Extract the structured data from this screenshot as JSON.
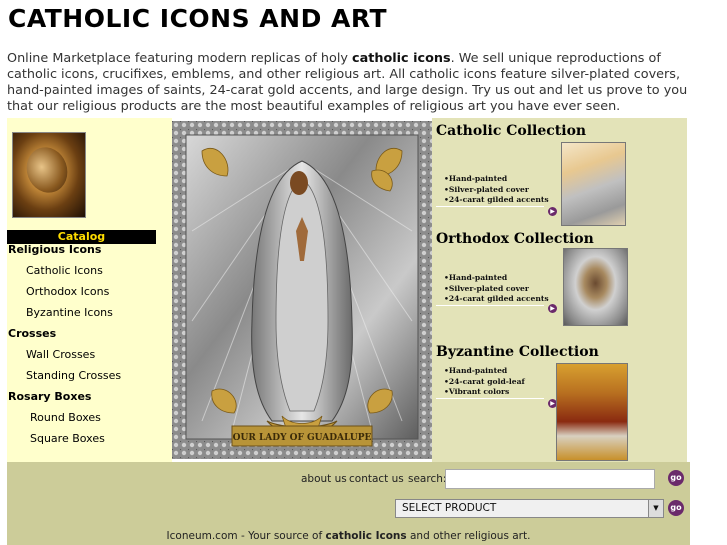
{
  "title": "CATHOLIC ICONS AND ART",
  "intro": {
    "part1": "Online Marketplace featuring modern replicas of holy ",
    "bold": "catholic icons",
    "part2": ". We sell unique reproductions of catholic icons, crucifixes, emblems, and other religious art. All catholic icons feature silver-plated covers, hand-painted images of saints, 24-carat gold accents, and large design. Try us out and let us prove to you that our religious products are the most beautiful examples of religious art you have ever seen."
  },
  "sidebar": {
    "catalog_label": "Catalog",
    "items": [
      {
        "label": "Religious Icons",
        "heading": true
      },
      {
        "label": "Catholic Icons",
        "heading": false
      },
      {
        "label": "Orthodox Icons",
        "heading": false
      },
      {
        "label": "Byzantine Icons",
        "heading": false
      },
      {
        "label": "Crosses",
        "heading": true
      },
      {
        "label": "Wall Crosses",
        "heading": false
      },
      {
        "label": "Standing Crosses",
        "heading": false
      },
      {
        "label": "Rosary Boxes",
        "heading": true
      },
      {
        "label": "Round Boxes",
        "heading": false
      },
      {
        "label": "Square Boxes",
        "heading": false
      }
    ]
  },
  "main_image": {
    "caption": "OUR LADY OF GUADALUPE"
  },
  "collections": [
    {
      "title": "Catholic Collection",
      "features": [
        "Hand-painted",
        "Silver-plated cover",
        "24-carat gilded accents"
      ]
    },
    {
      "title": "Orthodox Collection",
      "features": [
        "Hand-painted",
        "Silver-plated cover",
        "24-carat gilded accents"
      ]
    },
    {
      "title": "Byzantine Collection",
      "features": [
        "Hand-painted",
        "24-carat gold-leaf",
        "Vibrant colors"
      ]
    }
  ],
  "bottom": {
    "about": "about us",
    "contact": "contact us",
    "search_label": "search:",
    "search_value": "",
    "go_label": "go",
    "select_value": "SELECT PRODUCT",
    "footer_part1": "Iconeum.com - Your source of ",
    "footer_bold": "catholic Icons",
    "footer_part2": " and other religious art."
  },
  "colors": {
    "sidebar_bg": "#ffffcc",
    "collections_bg": "#e3e3b8",
    "bottom_bg": "#cccc99",
    "accent_purple": "#6b2a6b",
    "catalog_text": "#ffdd00"
  }
}
